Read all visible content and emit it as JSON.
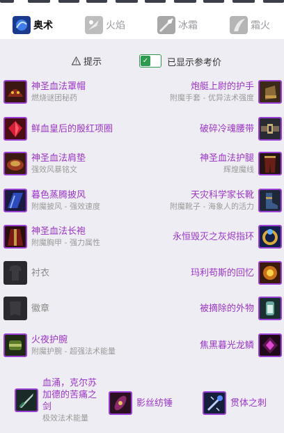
{
  "tabs": [
    {
      "label": "奥术",
      "icon": "arcane-spec-icon",
      "active": true
    },
    {
      "label": "火焰",
      "icon": "fire-spec-icon",
      "active": false
    },
    {
      "label": "冰霜",
      "icon": "frost-spec-icon",
      "active": false
    },
    {
      "label": "霜火",
      "icon": "frostfire-spec-icon",
      "active": false
    }
  ],
  "options": {
    "hint_label": "提示",
    "show_reference_label": "已显示参考价",
    "show_reference_checked": true
  },
  "gear_left": [
    {
      "name": "神圣血法罩帽",
      "sub": "燃烧谜团秘药",
      "icon": "helm-icon"
    },
    {
      "name": "鲜血皇后的殷红项圈",
      "sub": "",
      "icon": "necklace-icon"
    },
    {
      "name": "神圣血法肩垫",
      "sub": "强效风暴铭文",
      "icon": "shoulder-icon"
    },
    {
      "name": "暮色蒸腾披风",
      "sub": "附魔披风 - 强效速度",
      "icon": "cloak-icon"
    },
    {
      "name": "神圣血法长袍",
      "sub": "附魔胸甲 - 强力属性",
      "icon": "robe-icon"
    },
    {
      "name": "衬衣",
      "sub": "",
      "icon": "shirt-slot-icon",
      "empty": true
    },
    {
      "name": "徽章",
      "sub": "",
      "icon": "tabard-slot-icon",
      "empty": true
    },
    {
      "name": "火夜护腕",
      "sub": "附魔护腕 - 超强法术能量",
      "icon": "bracer-icon"
    }
  ],
  "gear_right": [
    {
      "name": "炮艇上尉的护手",
      "sub": "附魔手套 - 优异法术强度",
      "icon": "gloves-icon"
    },
    {
      "name": "破碎冷魂腰带",
      "sub": "",
      "icon": "belt-icon"
    },
    {
      "name": "神圣血法护腿",
      "sub": "辉煌魔线",
      "icon": "legs-icon"
    },
    {
      "name": "天灾科学家长靴",
      "sub": "附魔靴子 - 海象人的活力",
      "icon": "boots-icon"
    },
    {
      "name": "永恒毁灭之灰烬指环",
      "sub": "",
      "icon": "ring-icon"
    },
    {
      "name": "玛利苟斯的回忆",
      "sub": "",
      "icon": "trinket-memories-icon"
    },
    {
      "name": "被摘除的外物",
      "sub": "",
      "icon": "trinket-extract-icon"
    },
    {
      "name": "焦黑暮光龙鳞",
      "sub": "",
      "icon": "trinket-scale-icon"
    }
  ],
  "weapons": [
    {
      "name": "血涌，克尔苏加德的苦痛之剑",
      "sub": "极效法术能量",
      "icon": "sword-icon"
    },
    {
      "name": "影丝纺锤",
      "sub": "",
      "icon": "offhand-spindle-icon"
    },
    {
      "name": "贯体之刺",
      "sub": "",
      "icon": "wand-icon"
    }
  ],
  "colors": {
    "epic_purple": "#9b35c8",
    "panel_bg": "#eeedf3",
    "toggle_green": "#2e9a4f"
  }
}
